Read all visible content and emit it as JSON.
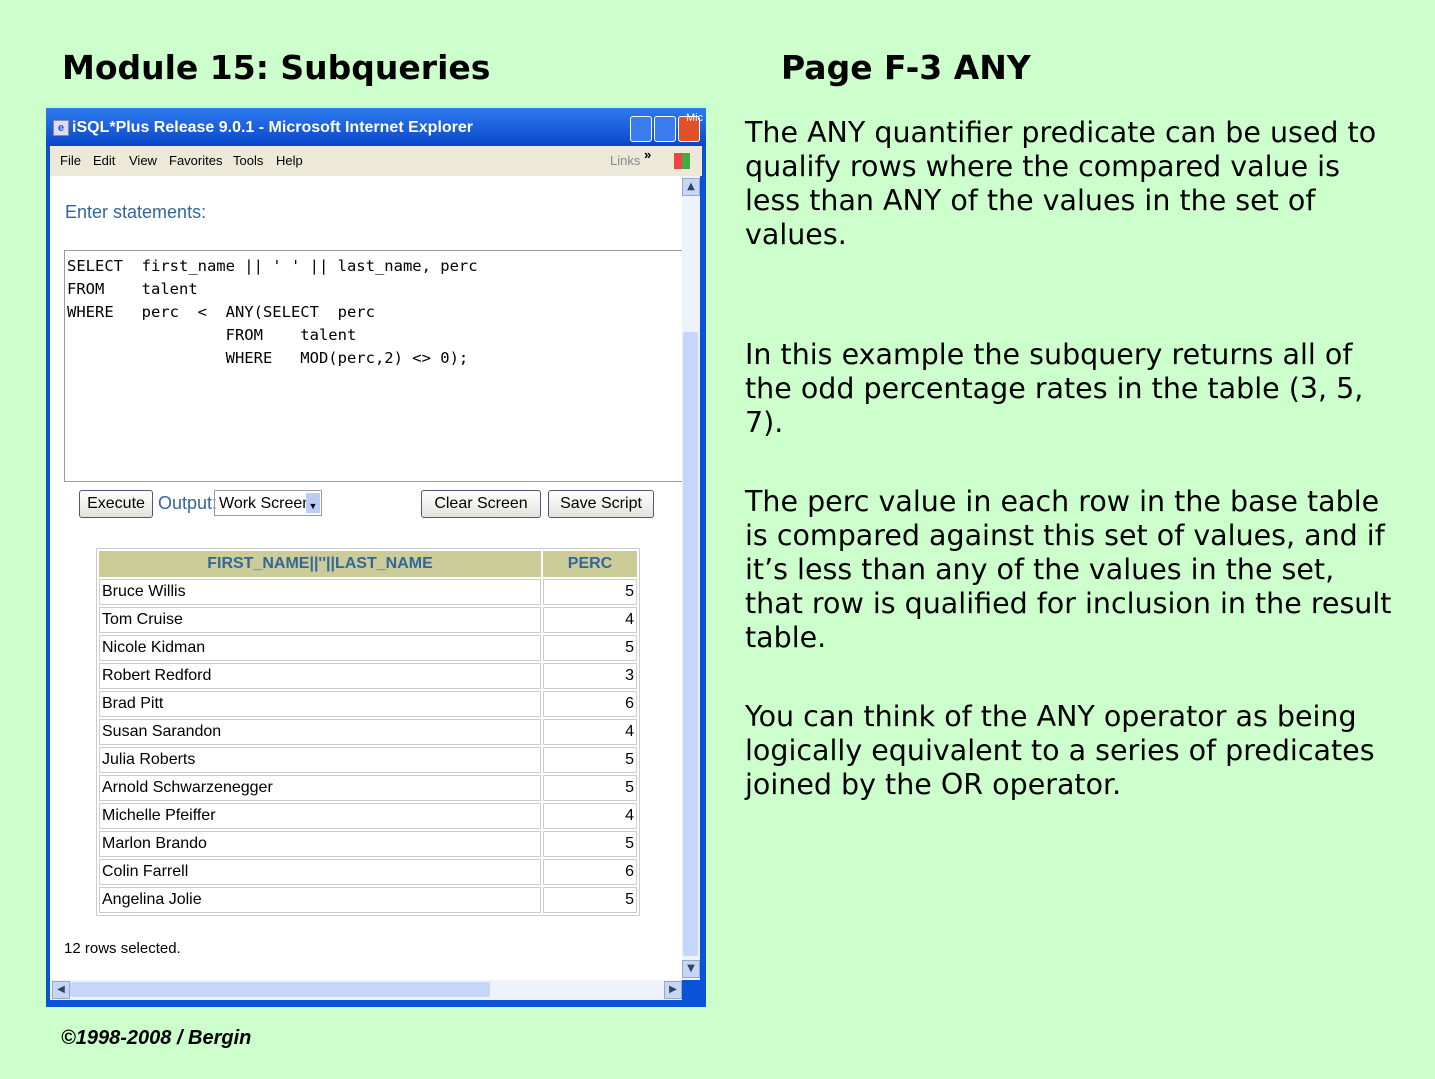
{
  "header": {
    "left": "Module 15: Subqueries",
    "right": "Page F-3  ANY"
  },
  "window": {
    "title": "iSQL*Plus Release 9.0.1 - Microsoft Internet Explorer",
    "tray_text": "Mic",
    "menu": [
      "File",
      "Edit",
      "View",
      "Favorites",
      "Tools",
      "Help"
    ],
    "links": "Links",
    "chevrons": "»"
  },
  "page": {
    "enter_label": "Enter statements:",
    "sql": "SELECT  first_name || ' ' || last_name, perc\nFROM    talent\nWHERE   perc  <  ANY(SELECT  perc\n                 FROM    talent\n                 WHERE   MOD(perc,2) <> 0);",
    "execute": "Execute",
    "output_label": "Output:",
    "output_value": "Work Screen",
    "clear": "Clear Screen",
    "save": "Save Script",
    "columns": [
      "FIRST_NAME||''||LAST_NAME",
      "PERC"
    ],
    "rows": [
      [
        "Bruce Willis",
        "5"
      ],
      [
        "Tom Cruise",
        "4"
      ],
      [
        "Nicole Kidman",
        "5"
      ],
      [
        "Robert Redford",
        "3"
      ],
      [
        "Brad Pitt",
        "6"
      ],
      [
        "Susan Sarandon",
        "4"
      ],
      [
        "Julia Roberts",
        "5"
      ],
      [
        "Arnold Schwarzenegger",
        "5"
      ],
      [
        "Michelle Pfeiffer",
        "4"
      ],
      [
        "Marlon Brando",
        "5"
      ],
      [
        "Colin Farrell",
        "6"
      ],
      [
        "Angelina Jolie",
        "5"
      ]
    ],
    "status": "12 rows selected."
  },
  "text": [
    "The ANY quantifier predicate can be used to qualify rows where the compared value is less than ANY of the values in the set of values.",
    "In this example the subquery returns all of the odd percentage rates in the table (3, 5, 7).",
    "The perc value in each row in the base table is compared against this set of values, and if it’s less than any of the values in the set, that row is qualified for inclusion in the result table.",
    "You can think of the ANY operator as being logically equivalent to a series of predicates joined by the OR operator."
  ],
  "footer": "©1998-2008 / Bergin"
}
